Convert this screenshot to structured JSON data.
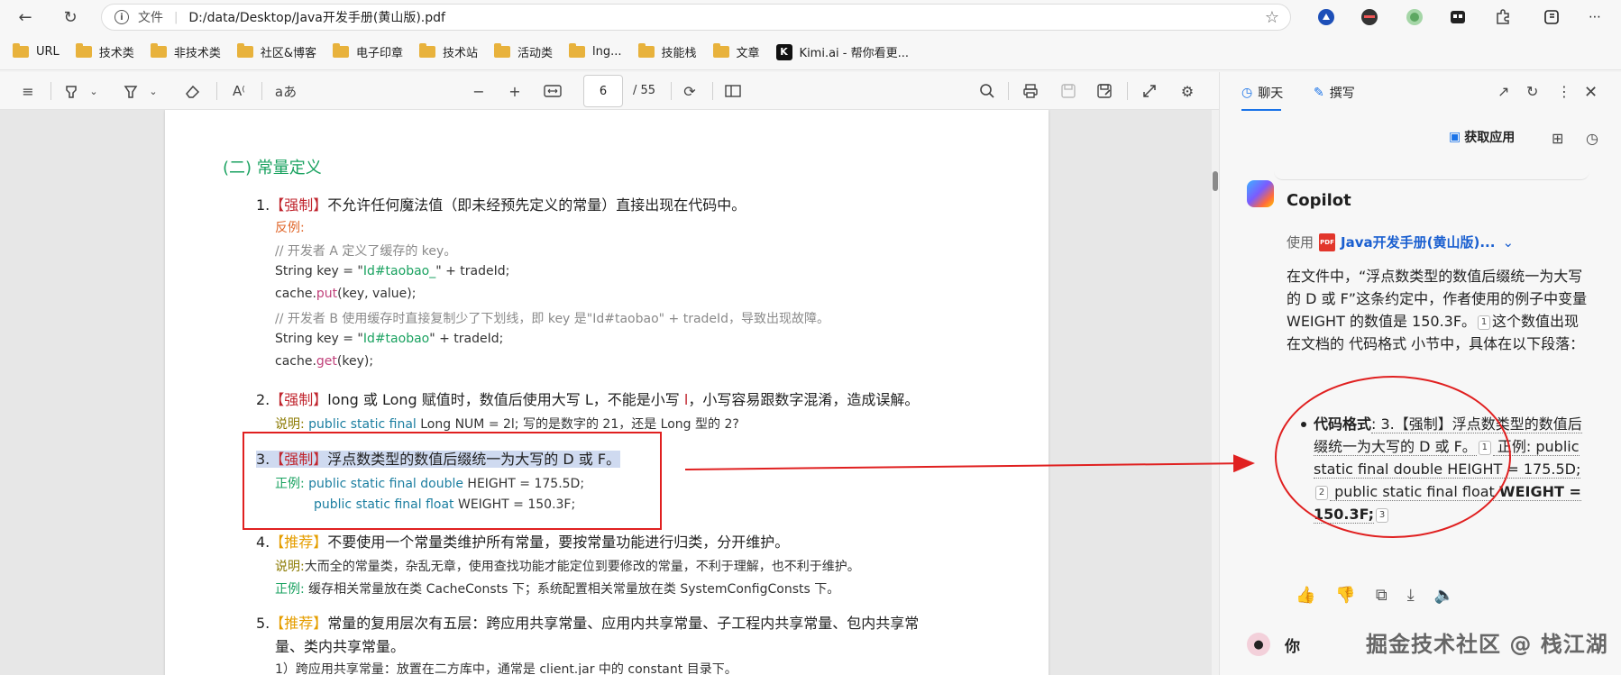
{
  "browser": {
    "file_label": "文件",
    "url": "D:/data/Desktop/Java开发手册(黄山版).pdf"
  },
  "bookmarks": [
    "URL",
    "技术类",
    "非技术类",
    "社区&博客",
    "电子印章",
    "技术站",
    "活动类",
    "lng...",
    "技能栈",
    "文章",
    "Kimi.ai - 帮你看更..."
  ],
  "pdf_toolbar": {
    "current_page": "6",
    "total_pages": "/ 55",
    "read_aloud_label": "aあ"
  },
  "pdf": {
    "section_heading": "(二) 常量定义",
    "item1": {
      "num": "1.",
      "tag": "【强制】",
      "text": "不允许任何魔法值（即未经预先定义的常量）直接出现在代码中。",
      "counter_label": "反例:",
      "lines": [
        "//  开发者 A 定义了缓存的 key。",
        "String key = \"",
        "Id#taobao_",
        "\" + tradeId;",
        "cache.",
        "put",
        "(key, value);",
        "// 开发者 B 使用缓存时直接复制少了下划线，即 key 是\"Id#taobao\" + tradeId，导致出现故障。",
        "Id#taobao",
        "get",
        "(key);"
      ]
    },
    "item2": {
      "num": "2.",
      "tag": "【强制】",
      "text_a": "long 或 Long 赋值时，数值后使用大写 L，不能是小写 ",
      "text_l": "l",
      "text_b": "，小写容易跟数字混淆，造成误解。",
      "note_label": "说明:",
      "note_code": "public static final",
      "note_rest": " Long NUM = 2l; 写的是数字的 21，还是 Long 型的 2?"
    },
    "item3": {
      "num": "3.",
      "tag": "【强制】",
      "text": "浮点数类型的数值后缀统一为大写的 D 或 F。",
      "example_label": "正例:",
      "code1_kw": "public static final double",
      "code1_rest": " HEIGHT = 175.5D;",
      "code2_kw": "public static final float",
      "code2_rest": " WEIGHT = 150.3F;"
    },
    "item4": {
      "num": "4.",
      "tag": "【推荐】",
      "text": "不要使用一个常量类维护所有常量，要按常量功能进行归类，分开维护。",
      "note_label": "说明:",
      "note": "大而全的常量类，杂乱无章，使用查找功能才能定位到要修改的常量，不利于理解，也不利于维护。",
      "example_label": "正例:",
      "example": "缓存相关常量放在类 CacheConsts 下；系统配置相关常量放在类 SystemConfigConsts 下。"
    },
    "item5": {
      "num": "5.",
      "tag": "【推荐】",
      "text": "常量的复用层次有五层：跨应用共享常量、应用内共享常量、子工程内共享常量、包内共享常",
      "text2": "量、类内共享常量。",
      "sub": "1）跨应用共享常量：放置在二方库中，通常是 client.jar 中的 constant 目录下。"
    }
  },
  "copilot": {
    "tab_chat": "聊天",
    "tab_compose": "撰写",
    "get_apps": "获取应用",
    "title": "Copilot",
    "use_label": "使用",
    "doc_name": "Java开发手册(黄山版)...",
    "answer_1": "在文件中，“浮点数类型的数值后缀统一为大写的 D 或 F”这条约定中，作者使用的例子中变量 WEIGHT 的数值是 150.3F。",
    "answer_2": "这个数值出现在文档的 代码格式 小节中，具体在以下段落：",
    "bullet_label": "代码格式",
    "bullet_a": ": 3.【强制】浮点数类型的数值后缀统一为大写的 D 或 F。",
    "bullet_b": " 正例: public static final double HEIGHT = 175.5D;",
    "bullet_c": " public static final float ",
    "bullet_bold": "WEIGHT = 150.3F;",
    "cite1": "1",
    "cite2": "2",
    "cite3": "3",
    "user_label": "你",
    "watermark": "掘金技术社区 @ 栈江湖"
  },
  "colors": {
    "accent": "#1a73e8",
    "annotation_red": "#e02020",
    "heading_green": "#1aa260",
    "tag_red": "#c0252e",
    "tag_orange": "#e59e00"
  }
}
